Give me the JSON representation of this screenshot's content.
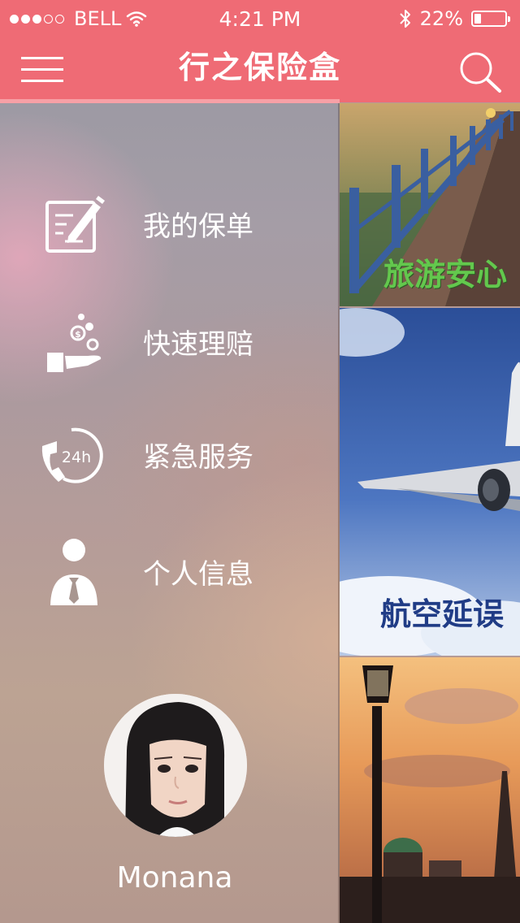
{
  "status_bar": {
    "carrier": "BELL",
    "time": "4:21 PM",
    "battery": "22%",
    "battery_level": 0.22
  },
  "header": {
    "title": "行之保险盒"
  },
  "menu": {
    "items": [
      {
        "label": "我的保单",
        "icon": "policy-document-icon"
      },
      {
        "label": "快速理赔",
        "icon": "claim-coins-icon"
      },
      {
        "label": "紧急服务",
        "icon": "phone-24h-icon"
      },
      {
        "label": "个人信息",
        "icon": "user-profile-icon"
      }
    ]
  },
  "user": {
    "name": "Monana"
  },
  "cards": [
    {
      "caption": "旅游安心",
      "image": "wooden-pier-scene"
    },
    {
      "caption": "航空延误",
      "image": "airplane-sky-scene"
    },
    {
      "caption": "",
      "image": "street-lamp-sunset-scene"
    }
  ],
  "colors": {
    "header": "#ef6b75",
    "accent_line": "#f7a0a6",
    "menu_text": "#ffffff"
  }
}
